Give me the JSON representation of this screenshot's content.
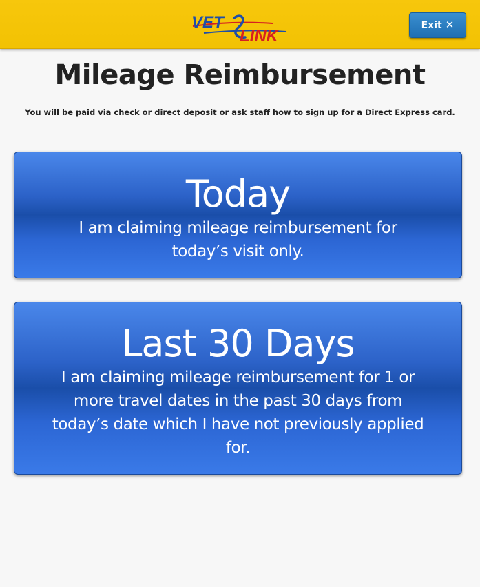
{
  "header": {
    "logo": {
      "left_text": "VET",
      "right_text": "LINK",
      "colors": {
        "red": "#d62020",
        "blue": "#1f4fa8"
      }
    },
    "exit_button": {
      "label": "Exit",
      "icon": "close-icon",
      "icon_glyph": "✕"
    }
  },
  "main": {
    "title": "Mileage Reimbursement",
    "subtitle": "You will be paid via check or direct deposit or ask staff how to sign up for a Direct Express card.",
    "options": [
      {
        "title": "Today",
        "description": "I am claiming mileage reimbursement for today’s visit only."
      },
      {
        "title": "Last 30 Days",
        "description": "I am claiming mileage reimbursement for 1 or more travel dates in the past 30 days from today’s date which I have not previously applied for."
      }
    ]
  },
  "colors": {
    "header_bg": "#f5c406",
    "accent_button": "#2a7fc4",
    "card_blue": "#2c62c8",
    "page_bg": "#f7f7f7"
  }
}
